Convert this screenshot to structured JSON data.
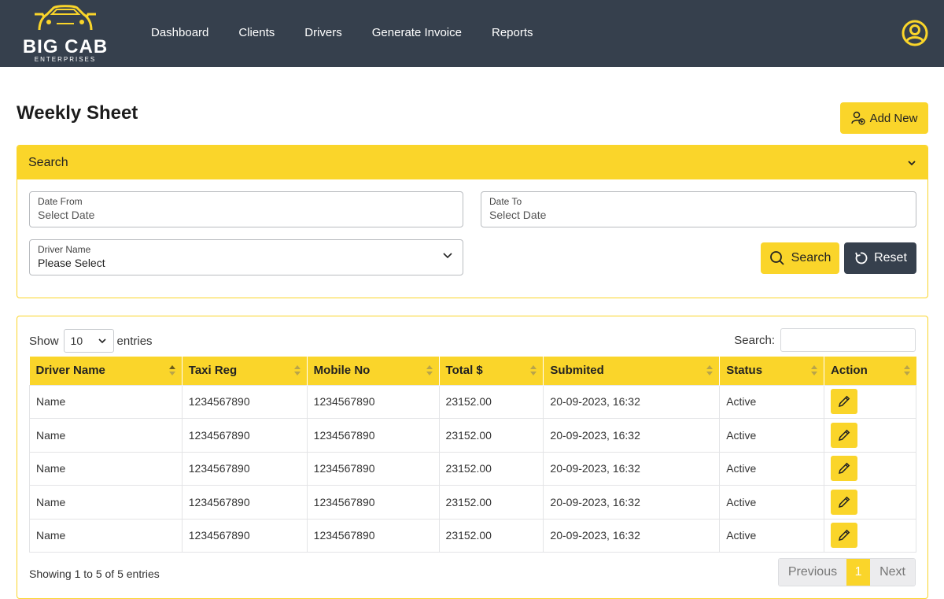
{
  "brand": {
    "name": "BIG CAB",
    "sub": "ENTERPRISES",
    "accent": "#fad52a",
    "nav_bg": "#36404d"
  },
  "nav": {
    "items": [
      {
        "label": "Dashboard"
      },
      {
        "label": "Clients"
      },
      {
        "label": "Drivers"
      },
      {
        "label": "Generate Invoice"
      },
      {
        "label": "Reports"
      }
    ],
    "user_icon": "user-circle-icon"
  },
  "page": {
    "title": "Weekly Sheet",
    "add_new_label": "Add New"
  },
  "search_panel": {
    "title": "Search",
    "date_from": {
      "label": "Date From",
      "placeholder": "Select Date"
    },
    "date_to": {
      "label": "Date To",
      "placeholder": "Select Date"
    },
    "driver": {
      "label": "Driver Name",
      "value": "Please Select"
    },
    "search_label": "Search",
    "reset_label": "Reset"
  },
  "table": {
    "show_label": "Show",
    "entries_value": "10",
    "entries_label": "entries",
    "search_label": "Search:",
    "columns": [
      "Driver Name",
      "Taxi Reg",
      "Mobile No",
      "Total $",
      "Submited",
      "Status",
      "Action"
    ],
    "rows": [
      {
        "driver": "Name",
        "taxi_reg": "1234567890",
        "mobile": "1234567890",
        "total": "23152.00",
        "submitted": "20-09-2023, 16:32",
        "status": "Active"
      },
      {
        "driver": "Name",
        "taxi_reg": "1234567890",
        "mobile": "1234567890",
        "total": "23152.00",
        "submitted": "20-09-2023, 16:32",
        "status": "Active"
      },
      {
        "driver": "Name",
        "taxi_reg": "1234567890",
        "mobile": "1234567890",
        "total": "23152.00",
        "submitted": "20-09-2023, 16:32",
        "status": "Active"
      },
      {
        "driver": "Name",
        "taxi_reg": "1234567890",
        "mobile": "1234567890",
        "total": "23152.00",
        "submitted": "20-09-2023, 16:32",
        "status": "Active"
      },
      {
        "driver": "Name",
        "taxi_reg": "1234567890",
        "mobile": "1234567890",
        "total": "23152.00",
        "submitted": "20-09-2023, 16:32",
        "status": "Active"
      }
    ],
    "footer": {
      "showing": "Showing 1 to 5 of 5 entries",
      "previous": "Previous",
      "page": "1",
      "next": "Next"
    }
  }
}
